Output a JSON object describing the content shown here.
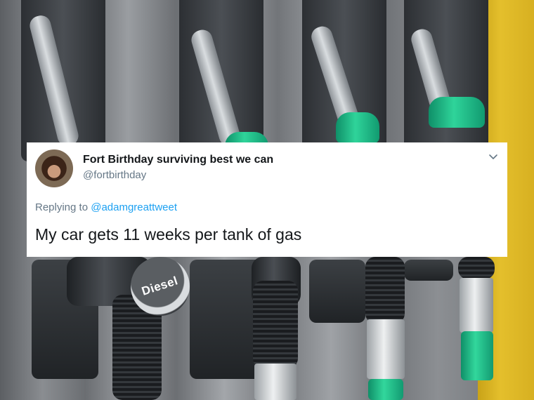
{
  "tweet": {
    "display_name": "Fort Birthday surviving best we can",
    "handle": "@fortbirthday",
    "replying_prefix": "Replying to ",
    "replying_to": "@adamgreattweet",
    "text": "My car gets 11 weeks per tank of gas"
  },
  "background": {
    "nozzle_label": "Diesel"
  },
  "colors": {
    "link": "#1da1f2",
    "nozzle_green": "#2fd49a",
    "secondary_text": "#657786"
  },
  "icons": {
    "menu": "chevron-down-icon"
  }
}
